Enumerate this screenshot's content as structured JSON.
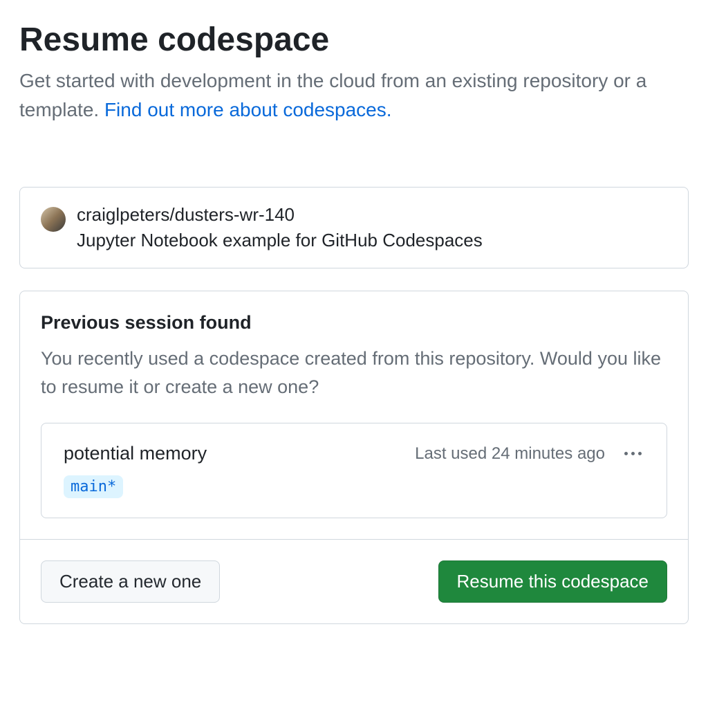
{
  "header": {
    "title": "Resume codespace",
    "subtitle_prefix": "Get started with development in the cloud from an existing repository or a template. ",
    "subtitle_link": "Find out more about codespaces."
  },
  "repo": {
    "full_name": "craiglpeters/dusters-wr-140",
    "description": "Jupyter Notebook example for GitHub Codespaces"
  },
  "session": {
    "heading": "Previous session found",
    "description": "You recently used a codespace created from this repository. Would you like to resume it or create a new one?",
    "codespace": {
      "name": "potential memory",
      "last_used": "Last used 24 minutes ago",
      "branch": "main*"
    }
  },
  "actions": {
    "create_label": "Create a new one",
    "resume_label": "Resume this codespace"
  }
}
